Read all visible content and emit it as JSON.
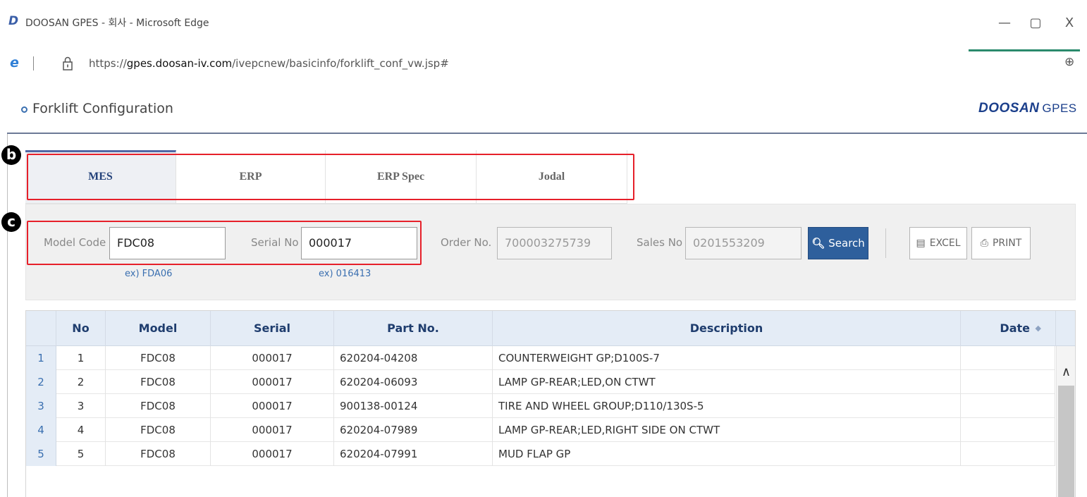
{
  "browser": {
    "window_title": "DOOSAN GPES - 회사 - Microsoft Edge",
    "app_logo": "D",
    "url_prefix": "https://",
    "url_host": "gpes.doosan-iv.com",
    "url_path": "/ivepcnew/basicinfo/forklift_conf_vw.jsp#",
    "minimize": "—",
    "maximize": "▢",
    "close": "X",
    "zoom_glyph": "⊕",
    "edge_glyph": "e"
  },
  "page": {
    "title": "Forklift Configuration",
    "brand_main": "DOOSAN",
    "brand_sub": "GPES"
  },
  "annotations": {
    "tabs_badge": "b",
    "search_badge": "c",
    "highlight_color": "#e6202a"
  },
  "tabs": [
    {
      "label": "MES",
      "active": true
    },
    {
      "label": "ERP",
      "active": false
    },
    {
      "label": "ERP Spec",
      "active": false
    },
    {
      "label": "Jodal",
      "active": false
    }
  ],
  "search": {
    "model_code_label": "Model Code",
    "model_code_value": "FDC08",
    "model_code_hint": "ex) FDA06",
    "serial_no_label": "Serial No",
    "serial_no_value": "000017",
    "serial_no_hint": "ex) 016413",
    "order_no_label": "Order No.",
    "order_no_value": "700003275739",
    "sales_no_label": "Sales No",
    "sales_no_value": "0201553209",
    "search_button": "Search",
    "excel_button": "EXCEL",
    "print_button": "PRINT"
  },
  "table": {
    "columns": [
      "No",
      "Model",
      "Serial",
      "Part No.",
      "Description",
      "Date"
    ],
    "rows": [
      {
        "rownum": "1",
        "no": "1",
        "model": "FDC08",
        "serial": "000017",
        "part_no": "620204-04208",
        "description": "COUNTERWEIGHT GP;D100S-7",
        "date": ""
      },
      {
        "rownum": "2",
        "no": "2",
        "model": "FDC08",
        "serial": "000017",
        "part_no": "620204-06093",
        "description": "LAMP GP-REAR;LED,ON CTWT",
        "date": ""
      },
      {
        "rownum": "3",
        "no": "3",
        "model": "FDC08",
        "serial": "000017",
        "part_no": "900138-00124",
        "description": "TIRE AND WHEEL GROUP;D110/130S-5",
        "date": ""
      },
      {
        "rownum": "4",
        "no": "4",
        "model": "FDC08",
        "serial": "000017",
        "part_no": "620204-07989",
        "description": "LAMP GP-REAR;LED,RIGHT SIDE ON CTWT",
        "date": ""
      },
      {
        "rownum": "5",
        "no": "5",
        "model": "FDC08",
        "serial": "000017",
        "part_no": "620204-07991",
        "description": "MUD FLAP GP",
        "date": ""
      }
    ]
  },
  "colors": {
    "accent": "#2e5f9c",
    "header_bg": "#e4ecf6",
    "brand": "#1b3f8b"
  }
}
